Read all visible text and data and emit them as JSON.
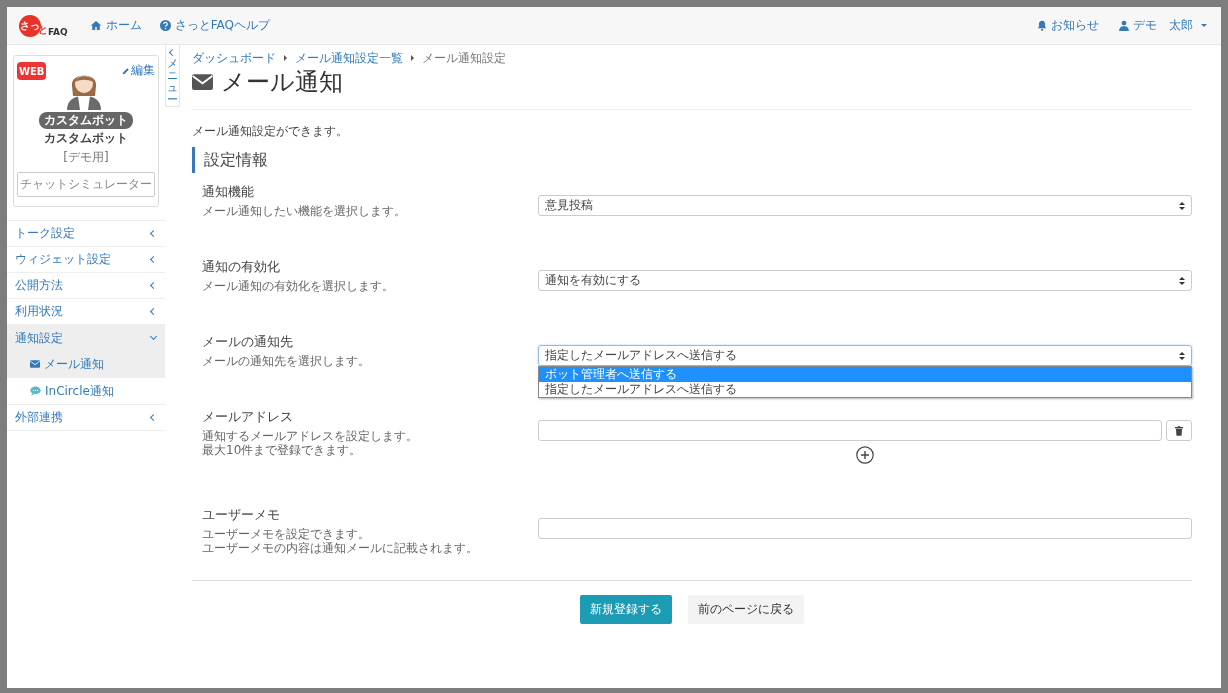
{
  "header": {
    "logo": {
      "mark": "さっ",
      "suffix": "と",
      "name": "FAQ"
    },
    "nav": [
      {
        "label": "ホーム"
      },
      {
        "label": "さっとFAQヘルプ"
      }
    ],
    "right": [
      {
        "label": "お知らせ"
      },
      {
        "label": "デモ　太郎",
        "caret": true
      }
    ]
  },
  "bot_card": {
    "badge": "WEB",
    "edit": "編集",
    "tag": "カスタムボット",
    "name": "カスタムボット",
    "note": "[デモ用]",
    "button": "チャットシミュレーター"
  },
  "menu_toggle": {
    "label": "メニュー"
  },
  "sidebar": {
    "items": [
      {
        "label": "トーク設定",
        "expanded": false
      },
      {
        "label": "ウィジェット設定",
        "expanded": false
      },
      {
        "label": "公開方法",
        "expanded": false
      },
      {
        "label": "利用状況",
        "expanded": false
      },
      {
        "label": "通知設定",
        "expanded": true,
        "children": [
          {
            "label": "メール通知",
            "selected": true
          },
          {
            "label": "InCircle通知",
            "selected": false
          }
        ]
      },
      {
        "label": "外部連携",
        "expanded": false
      }
    ]
  },
  "breadcrumb": [
    {
      "label": "ダッシュボード",
      "link": true
    },
    {
      "label": "メール通知設定一覧",
      "link": true
    },
    {
      "label": "メール通知設定",
      "link": false
    }
  ],
  "page_title": "メール通知",
  "description": "メール通知設定ができます。",
  "section_title": "設定情報",
  "fields": [
    {
      "kind": "select",
      "label": "通知機能",
      "help": [
        "メール通知したい機能を選択します。"
      ],
      "value": "意見投稿",
      "focused": false
    },
    {
      "kind": "select",
      "label": "通知の有効化",
      "help": [
        "メール通知の有効化を選択します。"
      ],
      "value": "通知を有効にする",
      "focused": false
    },
    {
      "kind": "select",
      "label": "メールの通知先",
      "help": [
        "メールの通知先を選択します。"
      ],
      "value": "指定したメールアドレスへ送信する",
      "focused": true,
      "options": [
        {
          "label": "ボット管理者へ送信する",
          "highlighted": true
        },
        {
          "label": "指定したメールアドレスへ送信する",
          "highlighted": false
        }
      ]
    },
    {
      "kind": "email_list",
      "label": "メールアドレス",
      "help": [
        "通知するメールアドレスを設定します。",
        "最大10件まで登録できます。"
      ]
    },
    {
      "kind": "text",
      "label": "ユーザーメモ",
      "help": [
        "ユーザーメモを設定できます。",
        "ユーザーメモの内容は通知メールに記載されます。"
      ]
    }
  ],
  "buttons": [
    {
      "label": "新規登録する",
      "kind": "primary"
    },
    {
      "label": "前のページに戻る",
      "kind": "secondary"
    }
  ]
}
